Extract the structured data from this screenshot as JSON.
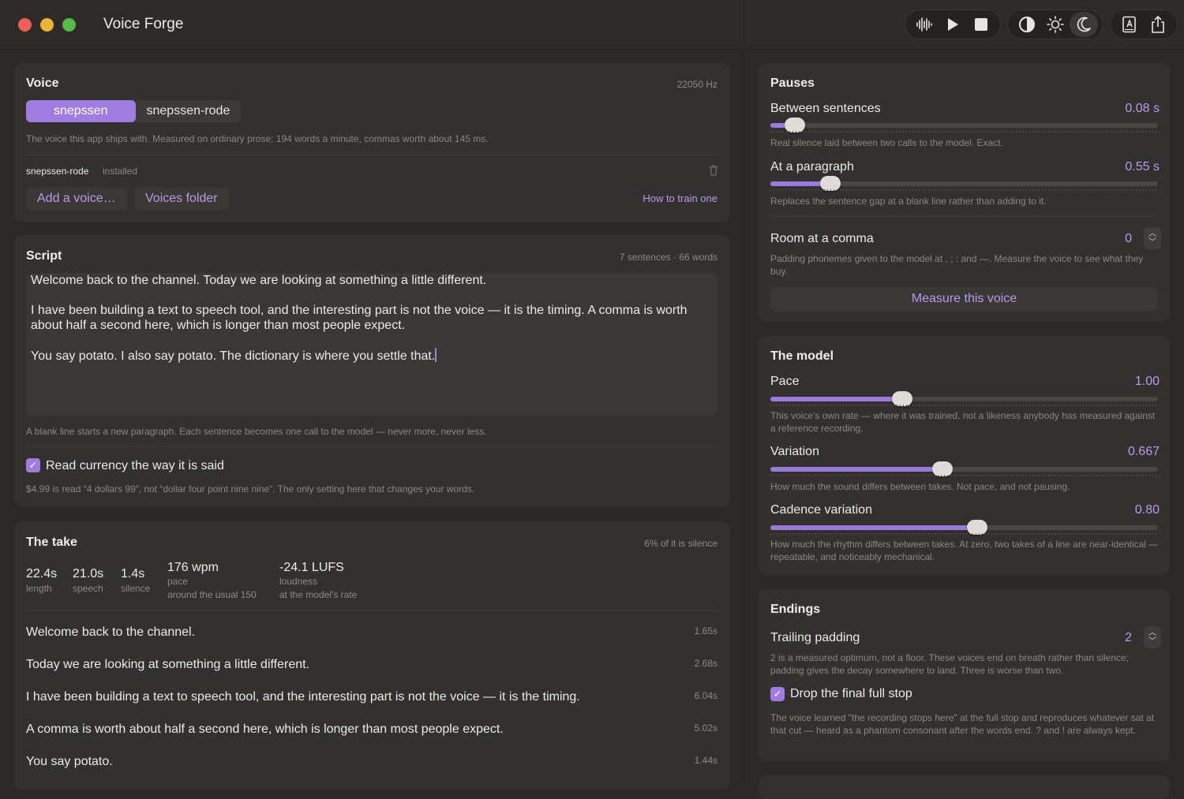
{
  "app": {
    "title": "Voice Forge"
  },
  "toolbar": {
    "groups": [
      [
        "waveform-icon",
        "play-icon",
        "stop-icon"
      ],
      [
        "contrast-icon",
        "sun-icon",
        "moon-icon"
      ],
      [
        "dictionary-icon",
        "share-icon"
      ]
    ],
    "active": "moon-icon"
  },
  "voice": {
    "title": "Voice",
    "sample_rate": "22050 Hz",
    "options": [
      "snepssen",
      "snepssen-rode"
    ],
    "selected": "snepssen",
    "description": "The voice this app ships with. Measured on ordinary prose: 194 words a minute, commas worth about 145 ms.",
    "installed_name": "snepssen-rode",
    "installed_status": "installed",
    "add_label": "Add a voice…",
    "folder_label": "Voices folder",
    "train_link": "How to train one"
  },
  "script": {
    "title": "Script",
    "counts": "7 sentences · 66 words",
    "paragraphs": [
      "Welcome back to the channel. Today we are looking at something a little different.",
      "I have been building a text to speech tool, and the interesting part is not the voice — it is the timing. A comma is worth about half a second here, which is longer than most people expect.",
      "You say potato. I also say potato. The dictionary is where you settle that."
    ],
    "help": "A blank line starts a new paragraph. Each sentence becomes one call to the model — never more, never less.",
    "currency_label": "Read currency the way it is said",
    "currency_checked": true,
    "currency_help": "$4.99 is read “4 dollars 99”, not “dollar four point nine nine”. The only setting here that changes your words."
  },
  "take": {
    "title": "The take",
    "silence_note": "6% of it is silence",
    "stats": [
      {
        "value": "22.4s",
        "label": "length"
      },
      {
        "value": "21.0s",
        "label": "speech"
      },
      {
        "value": "1.4s",
        "label": "silence"
      },
      {
        "value": "176 wpm",
        "label": "pace",
        "note": "around the usual 150"
      },
      {
        "value": "-24.1 LUFS",
        "label": "loudness",
        "note": "at the model's rate"
      }
    ],
    "sentences": [
      {
        "text": "Welcome back to the channel.",
        "duration": "1.65s"
      },
      {
        "text": "Today we are looking at something a little different.",
        "duration": "2.68s"
      },
      {
        "text": "I have been building a text to speech tool, and the interesting part is not the voice — it is the timing.",
        "duration": "6.04s"
      },
      {
        "text": "A comma is worth about half a second here, which is longer than most people expect.",
        "duration": "5.02s"
      },
      {
        "text": "You say potato.",
        "duration": "1.44s"
      }
    ]
  },
  "pauses": {
    "title": "Pauses",
    "between": {
      "label": "Between sentences",
      "value": "0.08 s",
      "fraction": 0.063,
      "help": "Real silence laid between two calls to the model. Exact."
    },
    "paragraph": {
      "label": "At a paragraph",
      "value": "0.55 s",
      "fraction": 0.154,
      "help": "Replaces the sentence gap at a blank line rather than adding to it."
    },
    "comma": {
      "label": "Room at a comma",
      "value": "0",
      "help": "Padding phonemes given to the model at , ; : and —. Measure the voice to see what they buy."
    },
    "measure_label": "Measure this voice"
  },
  "model": {
    "title": "The model",
    "pace": {
      "label": "Pace",
      "value": "1.00",
      "fraction": 0.341,
      "help": "This voice's own rate — where it was trained, not a likeness anybody has measured against a reference recording."
    },
    "variation": {
      "label": "Variation",
      "value": "0.667",
      "fraction": 0.445,
      "help": "How much the sound differs between takes. Not pace, and not pausing."
    },
    "cadence": {
      "label": "Cadence variation",
      "value": "0.80",
      "fraction": 0.533,
      "help": "How much the rhythm differs between takes. At zero, two takes of a line are near-identical — repeatable, and noticeably mechanical."
    }
  },
  "endings": {
    "title": "Endings",
    "trailing": {
      "label": "Trailing padding",
      "value": "2",
      "help": "2 is a measured optimum, not a floor. These voices end on breath rather than silence; padding gives the decay somewhere to land. Three is worse than two."
    },
    "drop_label": "Drop the final full stop",
    "drop_checked": true,
    "drop_help": "The voice learned \"the recording stops here\" at the full stop and reproduces whatever sat at that cut — heard as a phantom consonant after the words end. ? and ! are always kept."
  },
  "colors": {
    "accent": "#a07ce0",
    "background": "#2b2826",
    "card": "#333030"
  }
}
